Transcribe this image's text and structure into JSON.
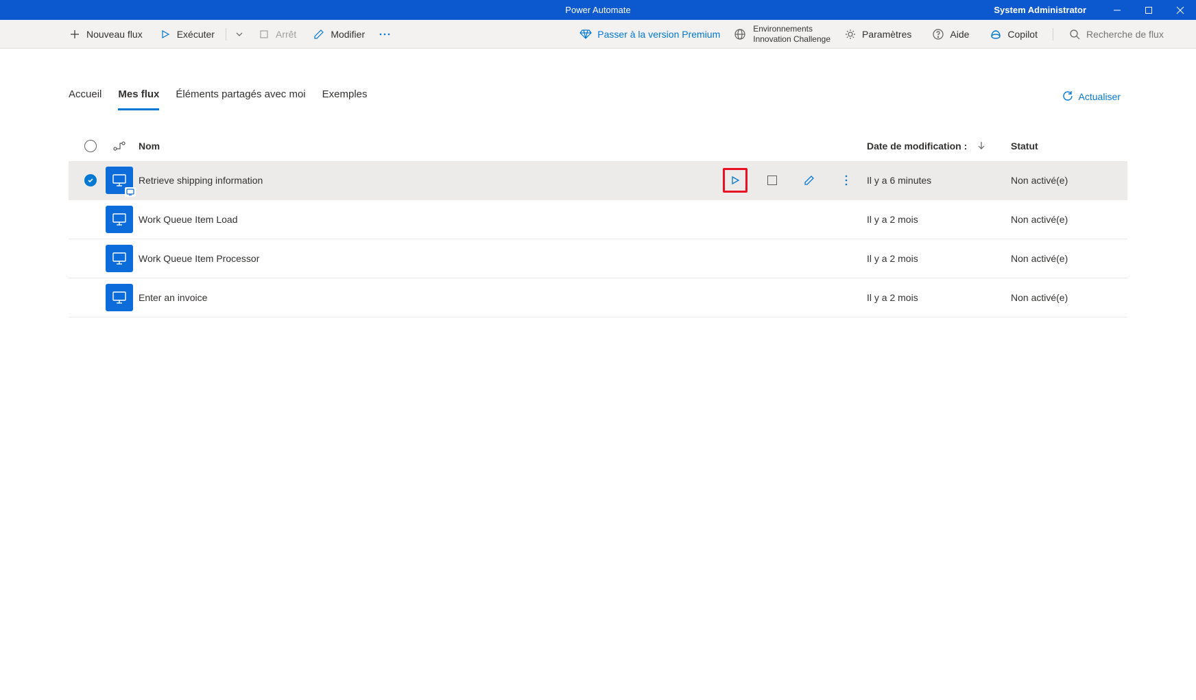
{
  "titlebar": {
    "title": "Power Automate",
    "user": "System Administrator"
  },
  "toolbar": {
    "new_flow": "Nouveau flux",
    "run": "Exécuter",
    "stop": "Arrêt",
    "edit": "Modifier",
    "premium": "Passer à la version Premium",
    "env_label": "Environnements",
    "env_name": "Innovation Challenge",
    "settings": "Paramètres",
    "help": "Aide",
    "copilot": "Copilot",
    "search_placeholder": "Recherche de flux"
  },
  "tabs": {
    "home": "Accueil",
    "myflows": "Mes flux",
    "shared": "Éléments partagés avec moi",
    "examples": "Exemples",
    "refresh": "Actualiser"
  },
  "table": {
    "headers": {
      "name": "Nom",
      "date": "Date de modification :",
      "status": "Statut"
    },
    "rows": [
      {
        "name": "Retrieve shipping information",
        "date": "Il y a 6 minutes",
        "status": "Non activé(e)",
        "selected": true
      },
      {
        "name": "Work Queue Item Load",
        "date": "Il y a 2 mois",
        "status": "Non activé(e)",
        "selected": false
      },
      {
        "name": "Work Queue Item Processor",
        "date": "Il y a 2 mois",
        "status": "Non activé(e)",
        "selected": false
      },
      {
        "name": "Enter an invoice",
        "date": "Il y a 2 mois",
        "status": "Non activé(e)",
        "selected": false
      }
    ]
  }
}
